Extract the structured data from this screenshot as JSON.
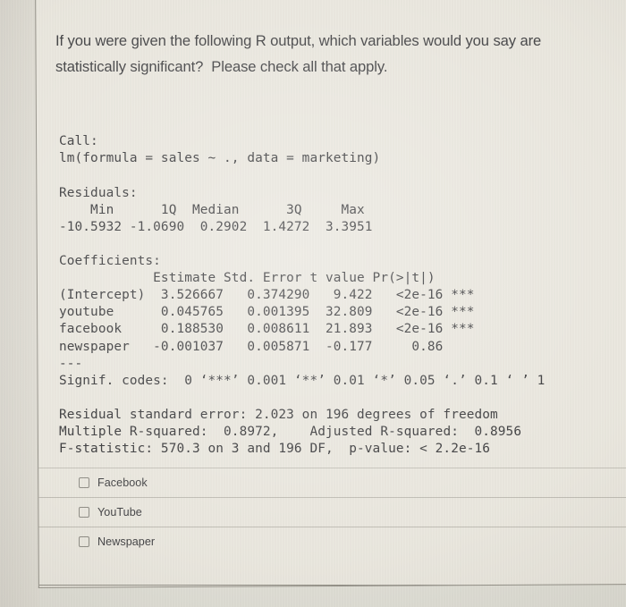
{
  "prompt": {
    "line1": "If you were given the following R output, which variables would you say are",
    "line2": "statistically significant?  Please check all that apply."
  },
  "r_output": {
    "call_header": "Call:",
    "call_formula": "lm(formula = sales ~ ., data = marketing)",
    "residuals_header": "Residuals:",
    "residuals_cols": "    Min      1Q  Median      3Q     Max ",
    "residuals_vals": "-10.5932 -1.0690  0.2902  1.4272  3.3951 ",
    "coefficients_header": "Coefficients:",
    "coef_cols": "            Estimate Std. Error t value Pr(>|t|)    ",
    "coef_intercept": "(Intercept)  3.526667   0.374290   9.422   <2e-16 ***",
    "coef_youtube": "youtube      0.045765   0.001395  32.809   <2e-16 ***",
    "coef_facebook": "facebook     0.188530   0.008611  21.893   <2e-16 ***",
    "coef_newspaper": "newspaper   -0.001037   0.005871  -0.177     0.86    ",
    "separator": "---",
    "signif_codes": "Signif. codes:  0 ‘***’ 0.001 ‘**’ 0.01 ‘*’ 0.05 ‘.’ 0.1 ‘ ’ 1",
    "rse_line": "Residual standard error: 2.023 on 196 degrees of freedom",
    "rsq_line": "Multiple R-squared:  0.8972,\tAdjusted R-squared:  0.8956 ",
    "fstat_line": "F-statistic: 570.3 on 3 and 196 DF,  p-value: < 2.2e-16"
  },
  "model": {
    "type": "linear_regression",
    "formula": "sales ~ .",
    "data": "marketing",
    "residuals": {
      "min": -10.5932,
      "q1": -1.069,
      "median": 0.2902,
      "q3": 1.4272,
      "max": 3.3951
    },
    "coefficients": [
      {
        "term": "(Intercept)",
        "estimate": 3.526667,
        "std_error": 0.37429,
        "t_value": 9.422,
        "p_value": "<2e-16",
        "signif": "***"
      },
      {
        "term": "youtube",
        "estimate": 0.045765,
        "std_error": 0.001395,
        "t_value": 32.809,
        "p_value": "<2e-16",
        "signif": "***"
      },
      {
        "term": "facebook",
        "estimate": 0.18853,
        "std_error": 0.008611,
        "t_value": 21.893,
        "p_value": "<2e-16",
        "signif": "***"
      },
      {
        "term": "newspaper",
        "estimate": -0.001037,
        "std_error": 0.005871,
        "t_value": -0.177,
        "p_value": "0.86",
        "signif": ""
      }
    ],
    "residual_standard_error": 2.023,
    "degrees_of_freedom": 196,
    "r_squared": 0.8972,
    "adj_r_squared": 0.8956,
    "f_statistic": 570.3,
    "f_df1": 3,
    "f_df2": 196,
    "p_value": "< 2.2e-16"
  },
  "options": [
    {
      "label": "Facebook",
      "checked": false
    },
    {
      "label": "YouTube",
      "checked": false
    },
    {
      "label": "Newspaper",
      "checked": false
    }
  ],
  "colors": {
    "page_background": "#dedbd2",
    "card_background": "#e9e6dd",
    "card_border": "#8e8b82",
    "text": "#3a3a3c",
    "mono_text": "#2f2f31",
    "divider": "#bdbab1"
  }
}
